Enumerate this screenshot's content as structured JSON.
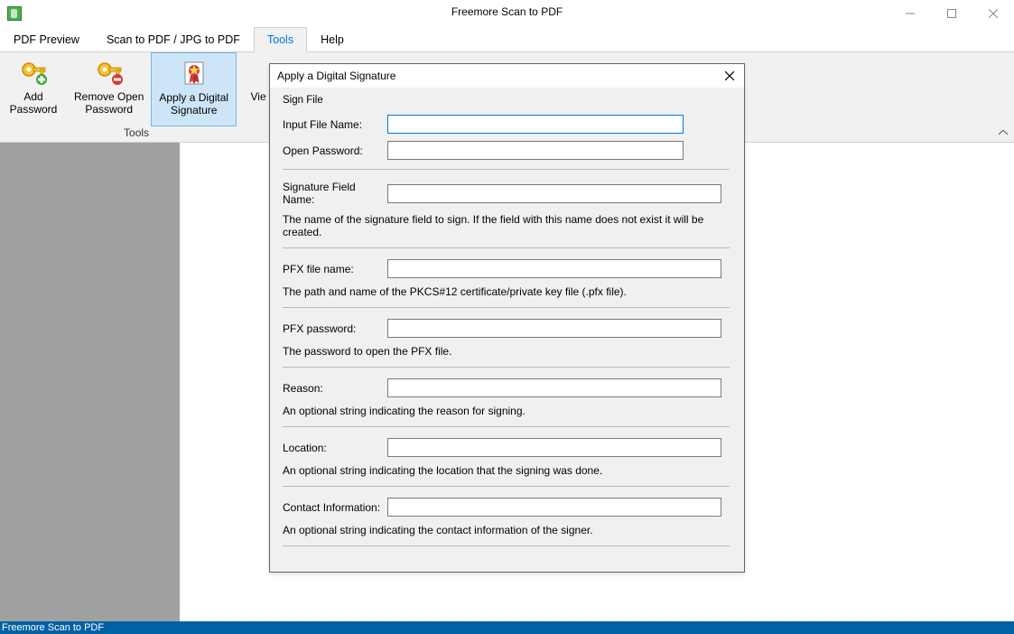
{
  "app_title": "Freemore Scan to PDF",
  "statusbar_text": "Freemore Scan to PDF",
  "menu": {
    "items": [
      "PDF Preview",
      "Scan to PDF / JPG to PDF",
      "Tools",
      "Help"
    ],
    "selected": "Tools"
  },
  "ribbon": {
    "group_label": "Tools",
    "buttons": [
      {
        "line1": "Add",
        "line2": "Password"
      },
      {
        "line1": "Remove Open",
        "line2": "Password"
      },
      {
        "line1": "Apply a Digital",
        "line2": "Signature"
      },
      {
        "line1": "Vie",
        "line2": ""
      }
    ]
  },
  "dialog": {
    "title": "Apply a Digital Signature",
    "group": "Sign File",
    "fields": {
      "input_file": {
        "label": "Input File Name:",
        "value": ""
      },
      "open_password": {
        "label": "Open Password:",
        "value": ""
      },
      "sig_field": {
        "label": "Signature Field Name:",
        "value": "",
        "help": "The name of the signature field to sign. If the field with this name does not exist it will be created."
      },
      "pfx_file": {
        "label": "PFX file name:",
        "value": "",
        "help": "The path and name of the PKCS#12 certificate/private key file (.pfx file)."
      },
      "pfx_password": {
        "label": "PFX password:",
        "value": "",
        "help": "The password to open the PFX file."
      },
      "reason": {
        "label": "Reason:",
        "value": "",
        "help": "An optional string indicating the reason for signing."
      },
      "location": {
        "label": "Location:",
        "value": "",
        "help": "An optional string indicating the location that the signing was done."
      },
      "contact": {
        "label": "Contact Information:",
        "value": "",
        "help": "An optional string indicating the contact information of the signer."
      }
    }
  }
}
